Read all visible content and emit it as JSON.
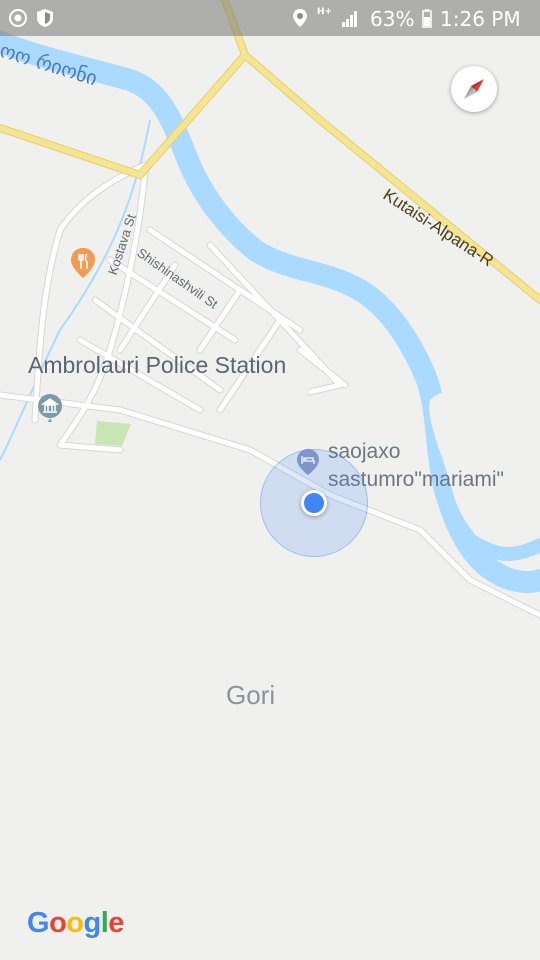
{
  "status_bar": {
    "network_type": "H+",
    "battery": "63%",
    "time": "1:26 PM"
  },
  "map": {
    "town_label": "Gori",
    "river_label": "ოო რიონი",
    "poi": {
      "police_station": "Ambrolauri Police Station",
      "hotel_line1": "saojaxo",
      "hotel_line2": "sastumro\"mariami\""
    },
    "streets": {
      "kostava": "Kostava St",
      "shishinashvili": "Shishinashvili St",
      "highway": "Kutaisi-Alpana-R"
    },
    "colors": {
      "background": "#f0f0ee",
      "water": "#aadaff",
      "highway": "#f4e594",
      "road": "#ffffff",
      "park": "#c8e6b4",
      "location": "#4285f4"
    }
  },
  "attribution": {
    "logo": [
      "G",
      "o",
      "o",
      "g",
      "l",
      "e"
    ],
    "logo_colors": [
      "#4285f4",
      "#ea4335",
      "#fbbc05",
      "#4285f4",
      "#34a853",
      "#ea4335"
    ]
  },
  "icons": {
    "compass": "compass-icon",
    "police": "museum-pin-icon",
    "food": "restaurant-pin-icon",
    "hotel": "hotel-pin-icon"
  }
}
